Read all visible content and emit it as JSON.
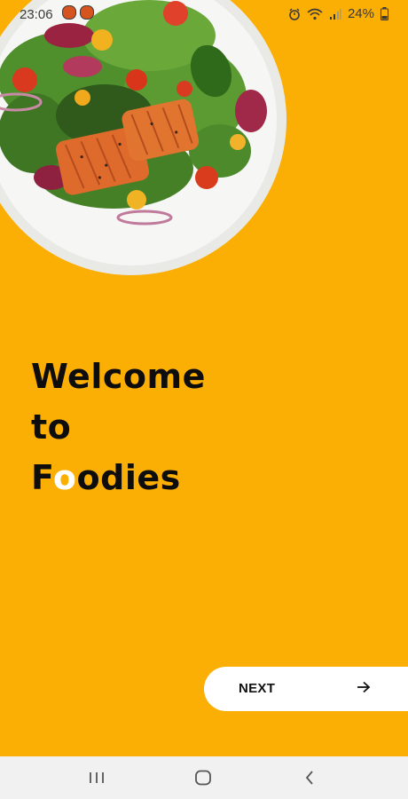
{
  "status_bar": {
    "time": "23:06",
    "battery": "24%",
    "icons": [
      "alarm-icon",
      "wifi-icon",
      "signal-icon",
      "battery-icon"
    ]
  },
  "hero": {
    "image": "salmon-salad-plate"
  },
  "welcome": {
    "line1": "Welcome",
    "line2": "to",
    "brand_first": "F",
    "brand_o": "o",
    "brand_rest": "odies"
  },
  "next_button": {
    "label": "NEXT",
    "icon": "arrow-right-icon"
  },
  "nav_bar": {
    "icons": [
      "recent-apps-icon",
      "home-icon",
      "back-icon"
    ]
  },
  "colors": {
    "background": "#FBAE03",
    "text": "#0D0D0D",
    "button": "#FFFFFF",
    "nav_bar": "#F1F1F1"
  }
}
